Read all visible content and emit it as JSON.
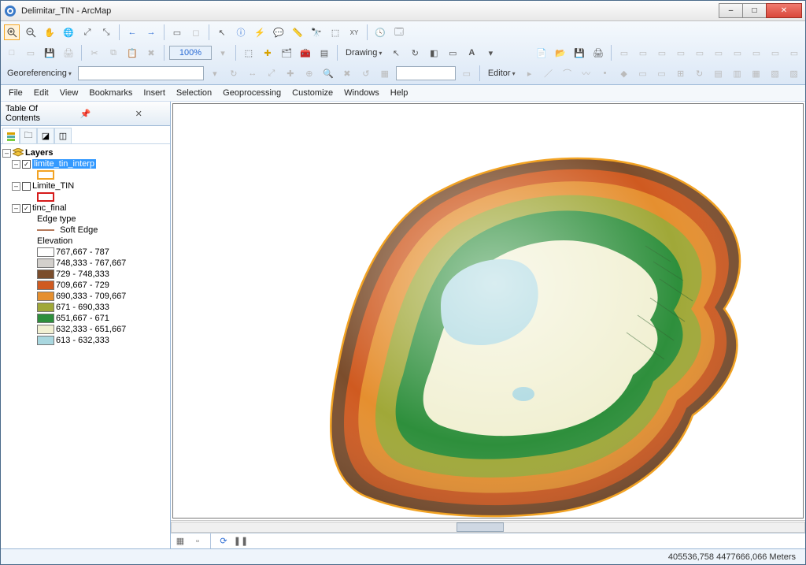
{
  "title": "Delimitar_TIN - ArcMap",
  "window_controls": {
    "min": "–",
    "max": "□",
    "close": "✕"
  },
  "menubar": [
    "File",
    "Edit",
    "View",
    "Bookmarks",
    "Insert",
    "Selection",
    "Geoprocessing",
    "Customize",
    "Windows",
    "Help"
  ],
  "toolbar": {
    "zoom_value": "100%",
    "drawing_label": "Drawing",
    "georef_label": "Georeferencing",
    "editor_label": "Editor"
  },
  "toc": {
    "title": "Table Of Contents",
    "layers_label": "Layers",
    "layer1": {
      "name": "limite_tin_interp",
      "checked": true,
      "swatch": "#f2a324"
    },
    "layer2": {
      "name": "Limite_TIN",
      "checked": false,
      "swatch": "#d61b1b"
    },
    "layer3": {
      "name": "tinc_final",
      "checked": true,
      "edge_type_label": "Edge type",
      "soft_edge_label": "Soft Edge",
      "soft_edge_color": "#b5795a",
      "elevation_label": "Elevation",
      "classes": [
        {
          "color": "#ffffff",
          "label": "767,667 - 787",
          "outline": true
        },
        {
          "color": "#d3d0cc",
          "label": "748,333 - 767,667"
        },
        {
          "color": "#7b4d2c",
          "label": "729 - 748,333"
        },
        {
          "color": "#cf5a20",
          "label": "709,667 - 729"
        },
        {
          "color": "#e58f2f",
          "label": "690,333 - 709,667"
        },
        {
          "color": "#a0a838",
          "label": "671 - 690,333"
        },
        {
          "color": "#2e8f3c",
          "label": "651,667 - 671"
        },
        {
          "color": "#f1f0d2",
          "label": "632,333 - 651,667"
        },
        {
          "color": "#a9d7df",
          "label": "613 - 632,333"
        }
      ]
    }
  },
  "status": {
    "coords": "405536,758  4477666,066 Meters"
  },
  "chart_data": {
    "type": "map",
    "title": "TIN elevation surface",
    "legend_field": "Elevation",
    "classes": [
      {
        "range": [
          767.667,
          787.0
        ],
        "color": "#ffffff"
      },
      {
        "range": [
          748.333,
          767.667
        ],
        "color": "#d3d0cc"
      },
      {
        "range": [
          729.0,
          748.333
        ],
        "color": "#7b4d2c"
      },
      {
        "range": [
          709.667,
          729.0
        ],
        "color": "#cf5a20"
      },
      {
        "range": [
          690.333,
          709.667
        ],
        "color": "#e58f2f"
      },
      {
        "range": [
          671.0,
          690.333
        ],
        "color": "#a0a838"
      },
      {
        "range": [
          651.667,
          671.0
        ],
        "color": "#2e8f3c"
      },
      {
        "range": [
          632.333,
          651.667
        ],
        "color": "#f1f0d2"
      },
      {
        "range": [
          613.0,
          632.333
        ],
        "color": "#a9d7df"
      }
    ],
    "edge_types": [
      "Soft Edge"
    ],
    "overlay_layers": [
      "limite_tin_interp"
    ],
    "cursor_coords": {
      "x": 405536.758,
      "y": 4477666.066,
      "units": "Meters"
    }
  }
}
